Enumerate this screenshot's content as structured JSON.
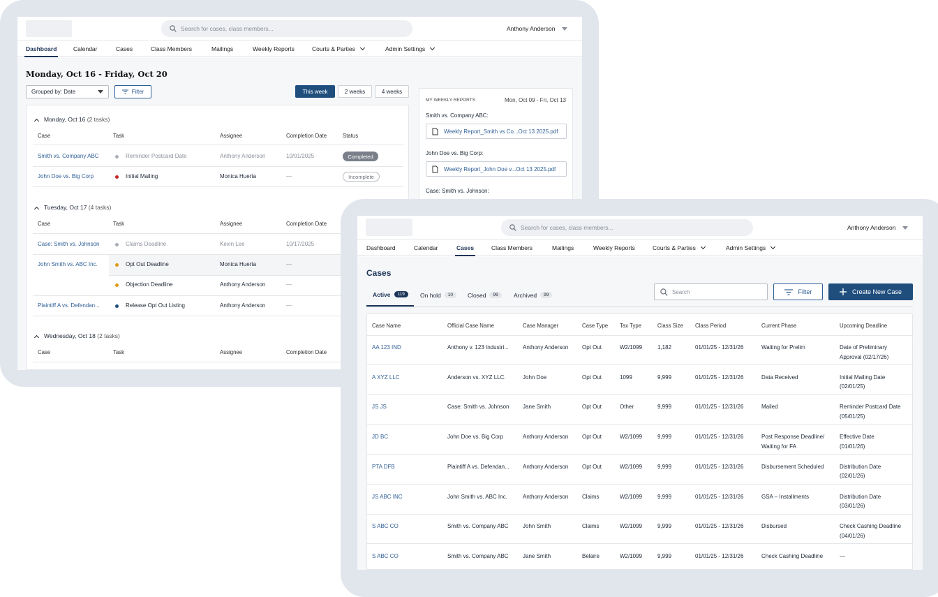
{
  "colors": {
    "primary": "#1f4e7d",
    "link": "#2f5f96",
    "nav_active": "#1d3557",
    "frame": "#e1e5ec",
    "dot_gray": "#a9adb5",
    "dot_red": "#c62828",
    "dot_orange": "#e09a12",
    "dot_navy": "#1f4e7d"
  },
  "back": {
    "search_placeholder": "Search for cases, class members...",
    "user": "Anthony Anderson",
    "nav": [
      "Dashboard",
      "Calendar",
      "Cases",
      "Class Members",
      "Mailings",
      "Weekly Reports",
      "Courts & Parties",
      "Admin Settings"
    ],
    "date_range": "Monday, Oct 16 - Friday, Oct 20",
    "grouped_by": "Grouped by: Date",
    "filter": "Filter",
    "range_buttons": [
      "This week",
      "2 weeks",
      "4 weeks"
    ],
    "groups": [
      {
        "day": "Monday, Oct 16",
        "count": "(2 tasks)",
        "headers": [
          "Case",
          "Task",
          "Assignee",
          "Completion Date",
          "Status"
        ],
        "rows": [
          {
            "case": "Smith vs. Company ABC",
            "task": "Reminder Postcard Date",
            "assignee": "Anthony Anderson",
            "date": "10/01/2025",
            "status": "Completed"
          },
          {
            "case": "John Doe vs. Big Corp",
            "task": "Initial Mailing",
            "assignee": "Monica Huerta",
            "date": "—",
            "status": "Incomplete"
          }
        ]
      },
      {
        "day": "Tuesday, Oct 17",
        "count": "(4 tasks)",
        "headers": [
          "Case",
          "Task",
          "Assignee",
          "Completion Date"
        ],
        "rows": [
          {
            "case": "Case: Smith vs. Johnson",
            "task": "Claims Deadline",
            "assignee": "Kevin Lee",
            "date": "10/17/2025"
          },
          {
            "case": "John Smith vs. ABC Inc.",
            "task": "Opt Out Deadline",
            "assignee": "Monica Huerta",
            "date": "—"
          },
          {
            "case": "",
            "task": "Objection Deadline",
            "assignee": "Anthony Anderson",
            "date": "—"
          },
          {
            "case": "Plaintiff A vs. Defendan...",
            "task": "Release Opt Out Listing",
            "assignee": "Anthony Anderson",
            "date": "—"
          }
        ]
      },
      {
        "day": "Wednesday, Oct 18",
        "count": "(2 tasks)",
        "headers": [
          "Case",
          "Task",
          "Assignee",
          "Completion Date"
        ],
        "rows": []
      }
    ],
    "reports": {
      "title": "MY WEEKLY REPORTS",
      "range": "Mon, Oct 09 -  Fri, Oct 13",
      "items": [
        {
          "case": "Smith vs. Company ABC:",
          "file": "Weekly Report_Smith vs Co...Oct 13 2025.pdf"
        },
        {
          "case": "John Doe vs. Big Corp:",
          "file": "Weekly Report_John Doe v...Oct 13 2025.pdf"
        },
        {
          "case": "Case: Smith vs. Johnson:",
          "file": ""
        }
      ]
    }
  },
  "front": {
    "search_placeholder": "Search for cases, class members...",
    "user": "Anthony Anderson",
    "nav": [
      "Dashboard",
      "Calendar",
      "Cases",
      "Class Members",
      "Mailings",
      "Weekly Reports",
      "Courts & Parties",
      "Admin Settings"
    ],
    "title": "Cases",
    "tabs": [
      {
        "label": "Active",
        "count": "119"
      },
      {
        "label": "On hold",
        "count": "10"
      },
      {
        "label": "Closed",
        "count": "99"
      },
      {
        "label": "Archived",
        "count": "99"
      }
    ],
    "search_placeholder2": "Search",
    "filter": "Filter",
    "create": "Create New Case",
    "headers": [
      "Case Name",
      "Official Case Name",
      "Case Manager",
      "Case Type",
      "Tax Type",
      "Class Size",
      "Class Period",
      "Current Phase",
      "Upcoming Deadline"
    ],
    "rows": [
      {
        "name": "AA 123 IND",
        "official": "Anthony v. 123 Industri...",
        "manager": "Anthony Anderson",
        "type": "Opt Out",
        "tax": "W2/1099",
        "size": "1,182",
        "period": "01/01/25 - 12/31/26",
        "phase": "Waiting for Prelim",
        "phase2": "",
        "deadline": "Date of Preliminary",
        "deadline2": "Approval (02/17/26)"
      },
      {
        "name": "A XYZ LLC",
        "official": "Anderson vs. XYZ LLC.",
        "manager": "John Doe",
        "type": "Opt Out",
        "tax": "1099",
        "size": "9,999",
        "period": "01/01/25 - 12/31/26",
        "phase": "Data Received",
        "phase2": "",
        "deadline": "Initial Mailing Date",
        "deadline2": "(02/01/25)"
      },
      {
        "name": "JS JS",
        "official": "Case: Smith vs. Johnson",
        "manager": "Jane Smith",
        "type": "Opt Out",
        "tax": "Other",
        "size": "9,999",
        "period": "01/01/25 - 12/31/26",
        "phase": "Mailed",
        "phase2": "",
        "deadline": "Reminder Postcard Date",
        "deadline2": "(05/01/25)"
      },
      {
        "name": "JD BC",
        "official": "John Doe vs. Big Corp",
        "manager": "Anthony Anderson",
        "type": "Opt Out",
        "tax": "W2/1099",
        "size": "9,999",
        "period": "01/01/25 - 12/31/26",
        "phase": "Post Response Deadline/",
        "phase2": "Waiting for FA",
        "deadline": "Effective Date",
        "deadline2": "(01/01/26)"
      },
      {
        "name": "PTA DFB",
        "official": "Plaintiff A vs. Defendan...",
        "manager": "Anthony Anderson",
        "type": "Opt Out",
        "tax": "W2/1099",
        "size": "9,999",
        "period": "01/01/25 - 12/31/26",
        "phase": "Disbursement Scheduled",
        "phase2": "",
        "deadline": "Distribution Date",
        "deadline2": "(02/01/26)"
      },
      {
        "name": "JS ABC INC",
        "official": "John Smith vs. ABC Inc.",
        "manager": "Anthony Anderson",
        "type": "Claims",
        "tax": "W2/1099",
        "size": "9,999",
        "period": "01/01/25 - 12/31/26",
        "phase": "GSA – Installments",
        "phase2": "",
        "deadline": "Distribution Date",
        "deadline2": "(03/01/26)"
      },
      {
        "name": "S ABC CO",
        "official": "Smith vs. Company ABC",
        "manager": "John Smith",
        "type": "Claims",
        "tax": "W2/1099",
        "size": "9,999",
        "period": "01/01/25 - 12/31/26",
        "phase": "Disbursed",
        "phase2": "",
        "deadline": "Check Cashing Deadline",
        "deadline2": "(04/01/26)"
      },
      {
        "name": "S ABC CO",
        "official": "Smith vs. Company ABC",
        "manager": "Jane Smith",
        "type": "Belaire",
        "tax": "W2/1099",
        "size": "9,999",
        "period": "01/01/25 - 12/31/26",
        "phase": "Check Cashing Deadline",
        "phase2": "",
        "deadline": "—",
        "deadline2": ""
      }
    ]
  }
}
